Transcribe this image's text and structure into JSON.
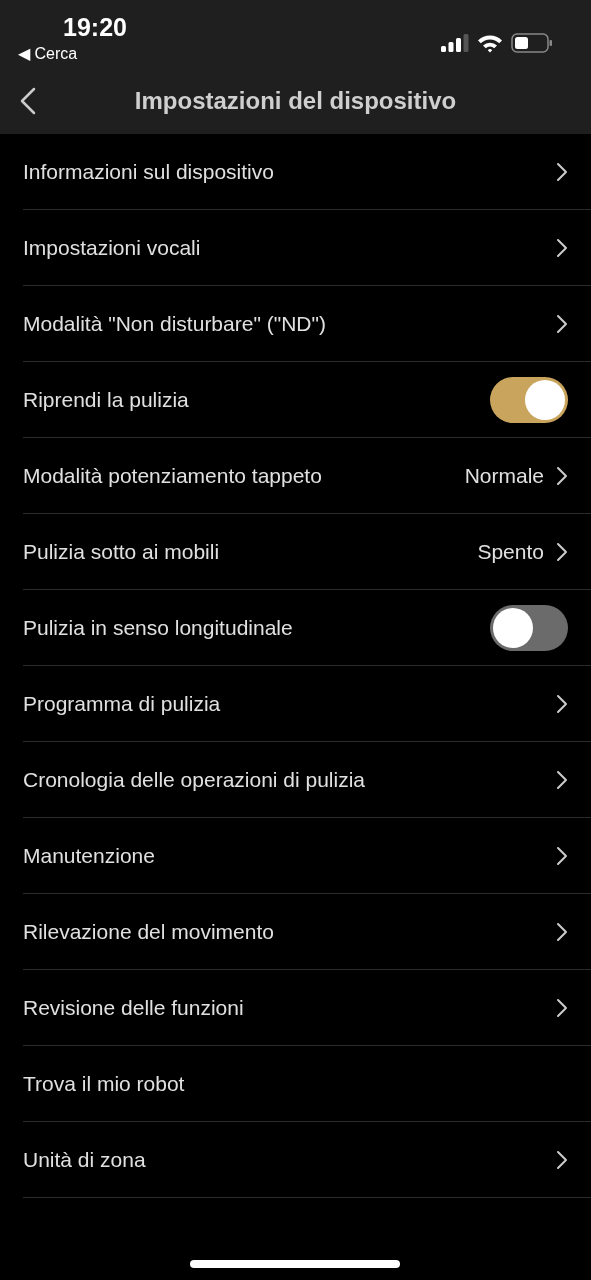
{
  "status_bar": {
    "time": "19:20",
    "back_app": "◀ Cerca"
  },
  "nav": {
    "title": "Impostazioni del dispositivo"
  },
  "rows": [
    {
      "kind": "link",
      "label": "Informazioni sul dispositivo"
    },
    {
      "kind": "link",
      "label": "Impostazioni vocali"
    },
    {
      "kind": "link",
      "label": "Modalità \"Non disturbare\" (\"ND\")"
    },
    {
      "kind": "toggle",
      "label": "Riprendi la pulizia",
      "on": true
    },
    {
      "kind": "value",
      "label": "Modalità potenziamento tappeto",
      "value": "Normale"
    },
    {
      "kind": "value",
      "label": "Pulizia sotto ai mobili",
      "value": "Spento"
    },
    {
      "kind": "toggle",
      "label": "Pulizia in senso longitudinale",
      "on": false
    },
    {
      "kind": "link",
      "label": "Programma di pulizia"
    },
    {
      "kind": "link",
      "label": "Cronologia delle operazioni di pulizia"
    },
    {
      "kind": "link",
      "label": "Manutenzione"
    },
    {
      "kind": "link",
      "label": "Rilevazione del movimento"
    },
    {
      "kind": "link",
      "label": "Revisione delle funzioni"
    },
    {
      "kind": "plain",
      "label": "Trova il mio robot"
    },
    {
      "kind": "link",
      "label": "Unità di zona"
    }
  ]
}
